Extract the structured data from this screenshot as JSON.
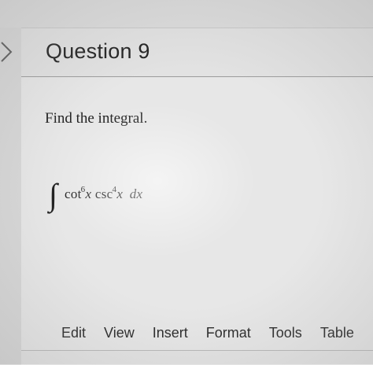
{
  "question": {
    "title": "Question 9",
    "prompt": "Find the integral.",
    "integral": {
      "sign": "∫",
      "f1": "cot",
      "e1": "6",
      "v1": "x",
      "f2": "csc",
      "e2": "4",
      "v2": "x",
      "dx": "dx"
    }
  },
  "editor_menu": {
    "items": [
      "Edit",
      "View",
      "Insert",
      "Format",
      "Tools",
      "Table"
    ]
  },
  "icons": {
    "collapse": "chevron-right-icon"
  }
}
